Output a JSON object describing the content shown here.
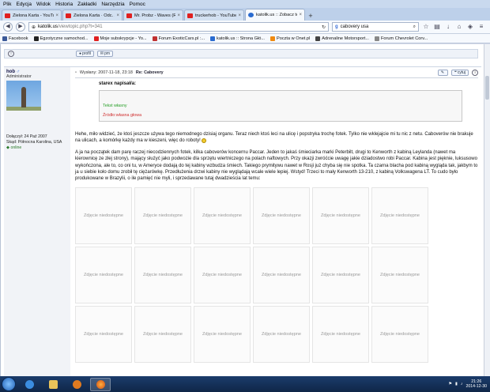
{
  "menu": [
    "Plik",
    "Edycja",
    "Widok",
    "Historia",
    "Zakładki",
    "Narzędzia",
    "Pomoc"
  ],
  "tabs": [
    {
      "title": "Zielona Karta - YouTube",
      "icon": "youtube-icon",
      "active": false
    },
    {
      "title": "Zielona Karta · Odc. 24 -...",
      "icon": "youtube-icon",
      "active": false
    },
    {
      "title": "Mr. Probz - Waves (Robin S...",
      "icon": "youtube-icon",
      "active": false
    },
    {
      "title": "truckerhob - YouTube",
      "icon": "youtube-icon",
      "active": false
    },
    {
      "title": "katolik.us :: Zobacz temat -...",
      "icon": "katolik-icon",
      "active": true
    }
  ],
  "nav": {
    "url_host": "katolik.us",
    "url_path": "/viewtopic.php?t=341",
    "search_value": "cabovery usa"
  },
  "bookmarks": [
    "Facebook",
    "Egzotyczne samochod...",
    "Moje subskrypcje - Yo...",
    "Forum ExoticCars.pl :...",
    "katolik.us :: Strona Głó...",
    "Poczta w Onet.pl",
    "Adrenaline Motorsport...",
    "Forum Chevrolet Corv..."
  ],
  "prev_post": {
    "profile_label": "profil",
    "pm_label": "pm"
  },
  "post": {
    "author": "hob",
    "rank": "Administrator",
    "joined": "Dołączył: 24 Paź 2007",
    "location": "Skąd: Północna Karolina, USA",
    "status": "online",
    "date": "Wysłany: 2007-11-18, 23:18",
    "subject_label": "Re: Cabovery",
    "edit_label": "",
    "quote_label": "cytuj",
    "quote": {
      "header": "starex napisał/a:",
      "green_text": "Tekst własny",
      "red_text": "Źródło:własna głowa"
    },
    "paragraphs": [
      "Hehe, miło widzieć, że ktoś jeszcze używa tego niemodnego dzisiaj organu. Teraz niech ktoś leci na ulicę i popstryka trochę fotek. Tylko nie wklejajcie mi tu nic z netu. Caboverów nie brakuje na ulicach, a komórkę każdy ma w kieszeni, więc do roboty!",
      "A ja na początek dam parę raczej niecodziennych fotek, kilka caboverów koncernu Paccar. Jeden to jakaś śmieciarka marki Peterbilt, drugi to Kenworth z kabiną Leylanda (nawet ma kierownicę ze złej strony), mający służyć jako podwozie dla sprzętu wiertniczego na polach naftowych. Przy okazji zwróćcie uwagę jakie dziadostwo robi Paccar. Kabina jest pięknie, luksusowo wykończona, ale to, co oni tu, w Ameryce dodają do tej kabiny wzbudza śmiech. Takiego prymitywu nawet w Rosji już chyba się nie spotka. Ta czarna blacha pod kabiną wygląda tak, jakbym to ja u siebie koło domu zrobił tę ciężarówkę. Przedłużenia drzwi kabiny nie wyglądają wcale wiele lepiej. Wstyd! Trzeci to mały Kenworth 13-210, z kabiną Volkswagena LT. To cudo było produkowane w Brazylii, o ile pamięć nie myli, i sprzedawane tutaj dwadzieścia lat temu:"
    ],
    "image_placeholder": "Zdjęcie niedostępne",
    "image_count": 18
  },
  "clock": {
    "time": "21:26",
    "date": "2014-12-30"
  }
}
